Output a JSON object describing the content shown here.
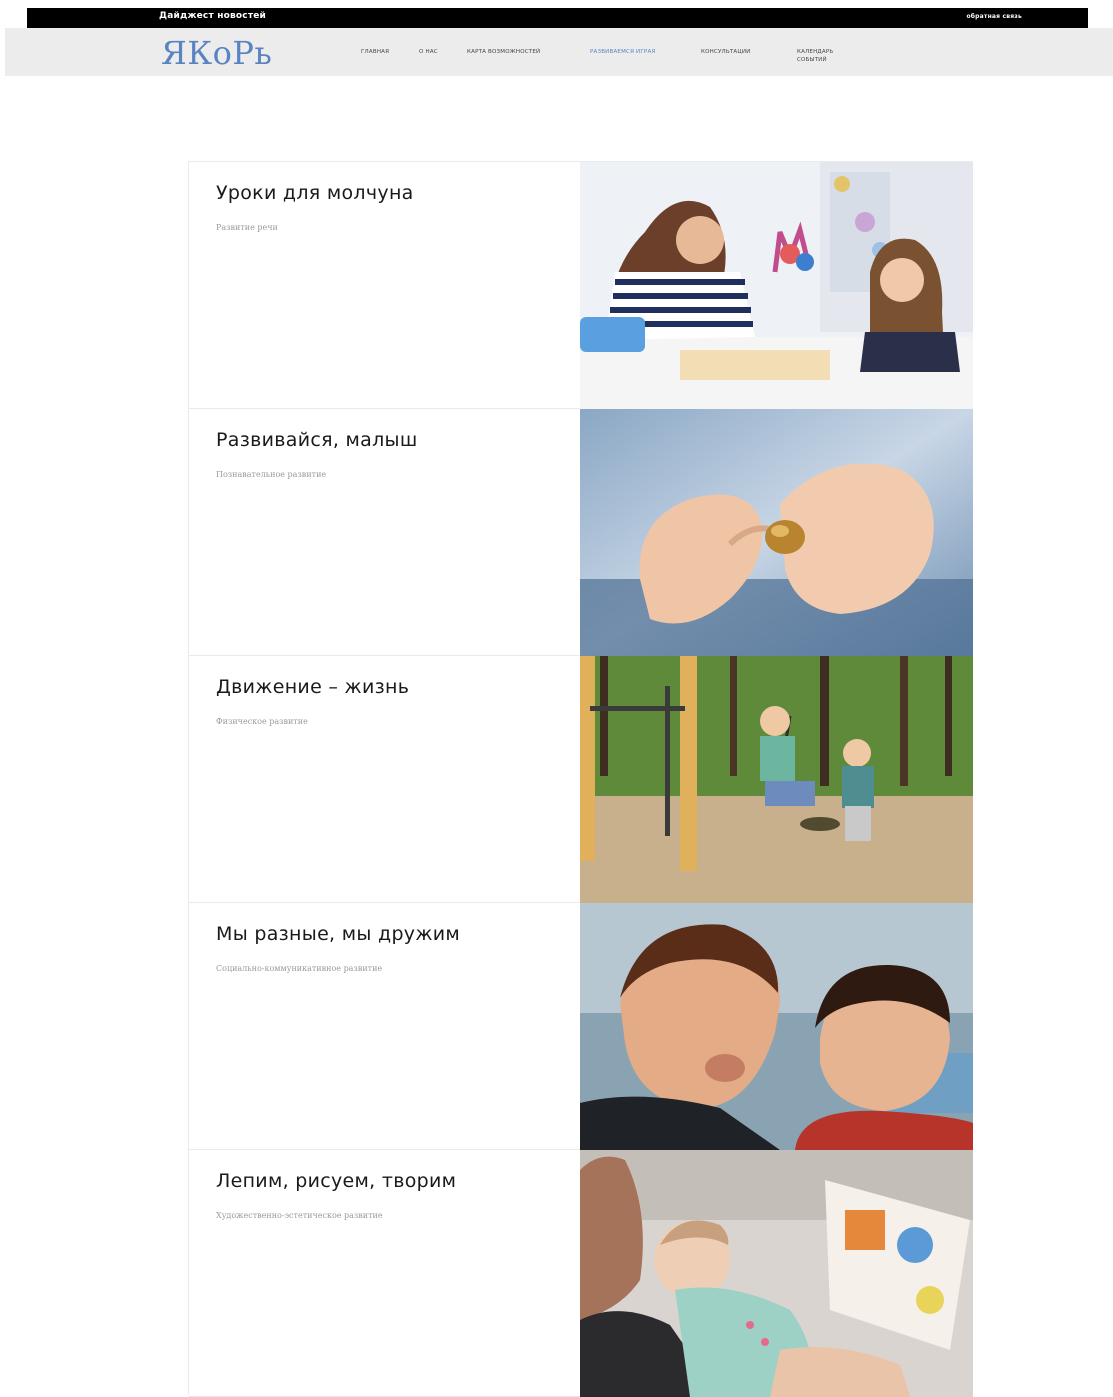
{
  "header": {
    "digest_label": "Дайджест новостей",
    "feedback_label": "обратная связь"
  },
  "brand": {
    "logo_text": "ЯКоРь",
    "logo_color": "#5b83c2"
  },
  "nav": {
    "items": [
      {
        "label": "главная",
        "active": false
      },
      {
        "label": "о нас",
        "active": false
      },
      {
        "label": "карта возможностей",
        "active": false
      },
      {
        "label": "развиваемся играя",
        "active": true
      },
      {
        "label": "консультации",
        "active": false
      },
      {
        "label": "календарь событий",
        "active": false
      }
    ]
  },
  "cards": [
    {
      "title": "Уроки для молчуна",
      "subtitle": "Развитие речи",
      "image": "teacher-and-girl-photo"
    },
    {
      "title": "Развивайся, малыш",
      "subtitle": "Познавательное развитие",
      "image": "child-hands-with-acorn-photo"
    },
    {
      "title": "Движение – жизнь",
      "subtitle": "Физическое развитие",
      "image": "kids-on-playground-photo"
    },
    {
      "title": "Мы разные, мы дружим",
      "subtitle": "Социально-коммуникативное развитие",
      "image": "boys-making-faces-photo"
    },
    {
      "title": "Лепим, рисуем, творим",
      "subtitle": "Художественно-эстетическое развитие",
      "image": "father-reading-to-baby-photo"
    }
  ]
}
